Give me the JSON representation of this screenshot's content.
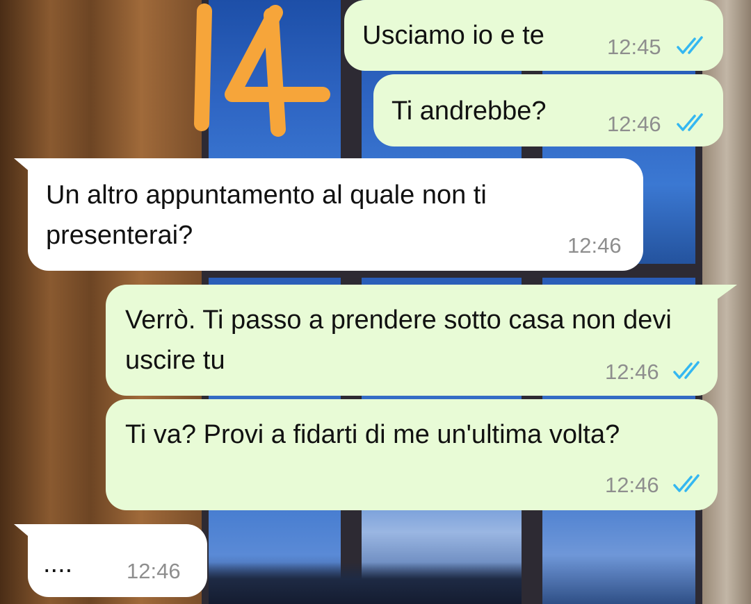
{
  "chat": {
    "sticker_text": "14",
    "messages": [
      {
        "direction": "outgoing",
        "text": "Usciamo io e te",
        "time": "12:45",
        "status": "read-double-tick-icon"
      },
      {
        "direction": "outgoing",
        "text": "Ti andrebbe?",
        "time": "12:46",
        "status": "read-double-tick-icon"
      },
      {
        "direction": "incoming",
        "text": "Un altro appuntamento al quale non ti presenterai?",
        "time": "12:46"
      },
      {
        "direction": "outgoing",
        "text": "Verrò. Ti passo a prendere sotto casa non devi uscire tu",
        "time": "12:46",
        "status": "read-double-tick-icon"
      },
      {
        "direction": "outgoing",
        "text": "Ti va? Provi a fidarti di me un'ultima volta?",
        "time": "12:46",
        "status": "read-double-tick-icon"
      },
      {
        "direction": "incoming",
        "text": "....",
        "time": "12:46"
      }
    ]
  },
  "colors": {
    "outgoing_bubble": "#e8fbd6",
    "incoming_bubble": "#ffffff",
    "read_tick": "#34b7f1",
    "sticker": "#f6a53a",
    "time_text": "#8e8e8e"
  }
}
